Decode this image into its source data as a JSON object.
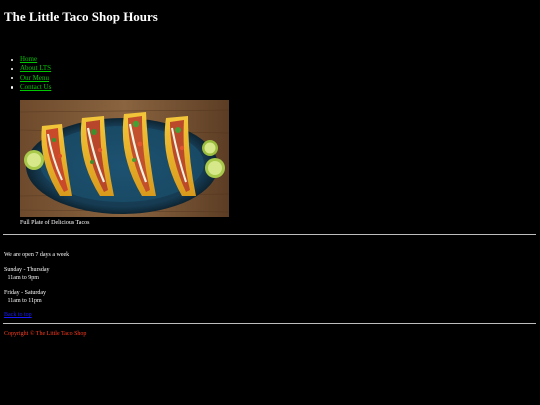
{
  "page": {
    "title": "The Little Taco Shop Hours"
  },
  "nav": {
    "items": [
      {
        "label": "Home"
      },
      {
        "label": "About LTS"
      },
      {
        "label": "Our Menu"
      },
      {
        "label": "Contact Us"
      }
    ]
  },
  "figure": {
    "caption": "Full Plate of Delicious Tacos"
  },
  "hours": {
    "intro": "We are open 7 days a week",
    "weekday_days": "Sunday - Thursday",
    "weekday_time": "11am to 9pm",
    "weekend_days": "Friday - Saturday",
    "weekend_time": "11am to 11pm"
  },
  "back_link": "Back to top",
  "footer": {
    "copyright": "Copyright © The Little Taco Shop"
  },
  "colors": {
    "background": "#000000",
    "text": "#ffffff",
    "nav_link": "#00c800",
    "back_link": "#1a1aff",
    "footer_text": "#ff3b1f",
    "rule": "#bdbdbd"
  }
}
